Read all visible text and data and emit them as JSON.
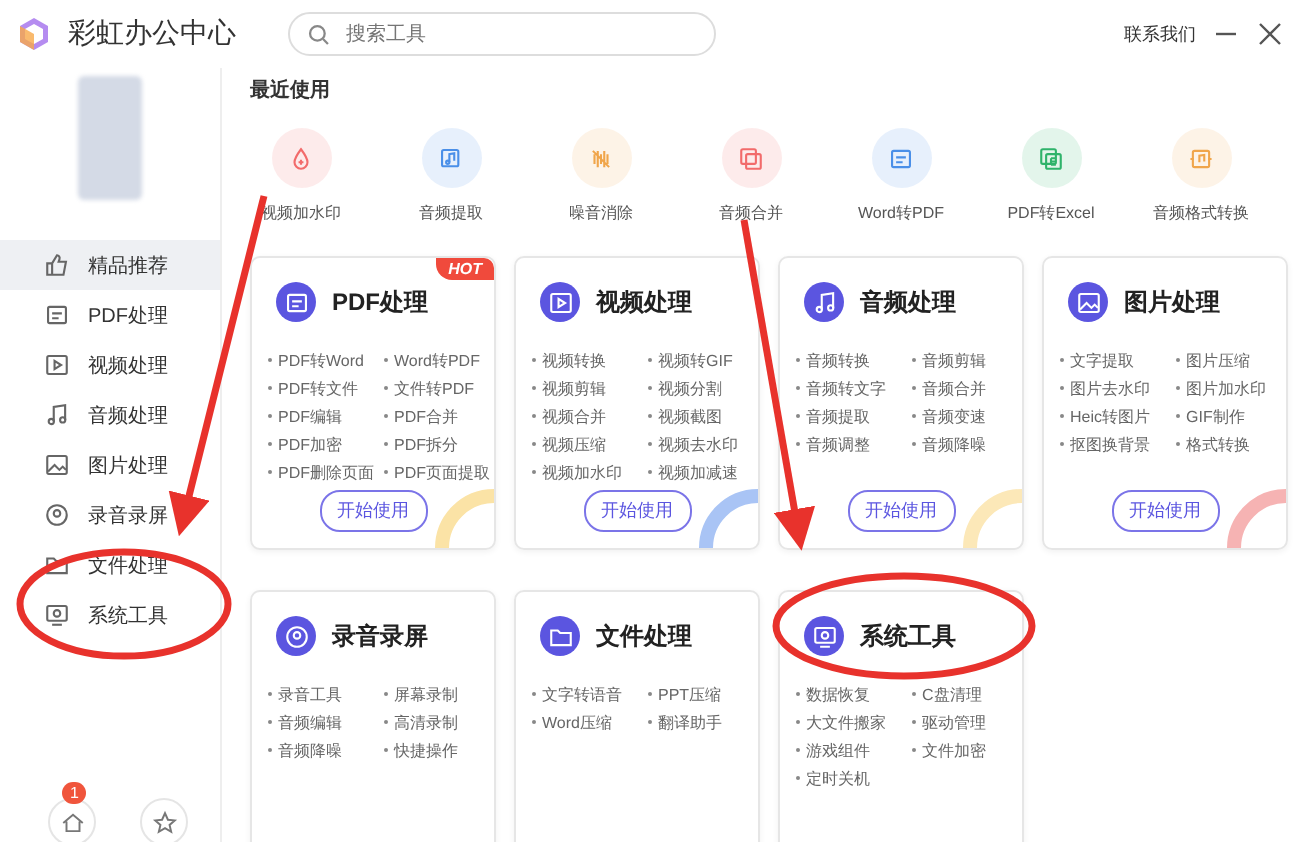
{
  "app": {
    "title": "彩虹办公中心"
  },
  "search": {
    "placeholder": "搜索工具"
  },
  "header_link": "联系我们",
  "sidebar": {
    "items": [
      {
        "label": "精品推荐",
        "kind": "thumb",
        "selected": true
      },
      {
        "label": "PDF处理",
        "kind": "pdf",
        "selected": false
      },
      {
        "label": "视频处理",
        "kind": "video",
        "selected": false
      },
      {
        "label": "音频处理",
        "kind": "music",
        "selected": false
      },
      {
        "label": "图片处理",
        "kind": "image",
        "selected": false
      },
      {
        "label": "录音录屏",
        "kind": "record",
        "selected": false
      },
      {
        "label": "文件处理",
        "kind": "folder",
        "selected": false
      },
      {
        "label": "系统工具",
        "kind": "system",
        "selected": false
      }
    ],
    "badge": "1"
  },
  "recent": {
    "title": "最近使用",
    "items": [
      {
        "label": "视频加水印",
        "kind": "drop",
        "color": "#f26b6b"
      },
      {
        "label": "音频提取",
        "kind": "audio",
        "color": "#4a8fe8"
      },
      {
        "label": "噪音消除",
        "kind": "noise",
        "color": "#f0a54a"
      },
      {
        "label": "音频合并",
        "kind": "merge",
        "color": "#f26b6b"
      },
      {
        "label": "Word转PDF",
        "kind": "pdf",
        "color": "#4a8fe8"
      },
      {
        "label": "PDF转Excel",
        "kind": "excel",
        "color": "#2fb36b"
      },
      {
        "label": "音频格式转换",
        "kind": "convert",
        "color": "#f0a54a"
      }
    ]
  },
  "cards": [
    {
      "title": "PDF处理",
      "kind": "pdf",
      "badge": "HOT",
      "items": [
        "PDF转Word",
        "Word转PDF",
        "PDF转文件",
        "文件转PDF",
        "PDF编辑",
        "PDF合并",
        "PDF加密",
        "PDF拆分",
        "PDF删除页面",
        "PDF页面提取"
      ],
      "button": "开始使用"
    },
    {
      "title": "视频处理",
      "kind": "video",
      "items": [
        "视频转换",
        "视频转GIF",
        "视频剪辑",
        "视频分割",
        "视频合并",
        "视频截图",
        "视频压缩",
        "视频去水印",
        "视频加水印",
        "视频加减速"
      ],
      "button": "开始使用"
    },
    {
      "title": "音频处理",
      "kind": "music",
      "items": [
        "音频转换",
        "音频剪辑",
        "音频转文字",
        "音频合并",
        "音频提取",
        "音频变速",
        "音频调整",
        "音频降噪"
      ],
      "button": "开始使用"
    },
    {
      "title": "图片处理",
      "kind": "image",
      "items": [
        "文字提取",
        "图片压缩",
        "图片去水印",
        "图片加水印",
        "Heic转图片",
        "GIF制作",
        "抠图换背景",
        "格式转换"
      ],
      "button": "开始使用"
    },
    {
      "title": "录音录屏",
      "kind": "record",
      "items": [
        "录音工具",
        "屏幕录制",
        "音频编辑",
        "高清录制",
        "音频降噪",
        "快捷操作"
      ]
    },
    {
      "title": "文件处理",
      "kind": "folder",
      "items": [
        "文字转语音",
        "PPT压缩",
        "Word压缩",
        "翻译助手"
      ]
    },
    {
      "title": "系统工具",
      "kind": "system",
      "items": [
        "数据恢复",
        "C盘清理",
        "大文件搬家",
        "驱动管理",
        "游戏组件",
        "文件加密",
        "定时关机"
      ]
    }
  ]
}
